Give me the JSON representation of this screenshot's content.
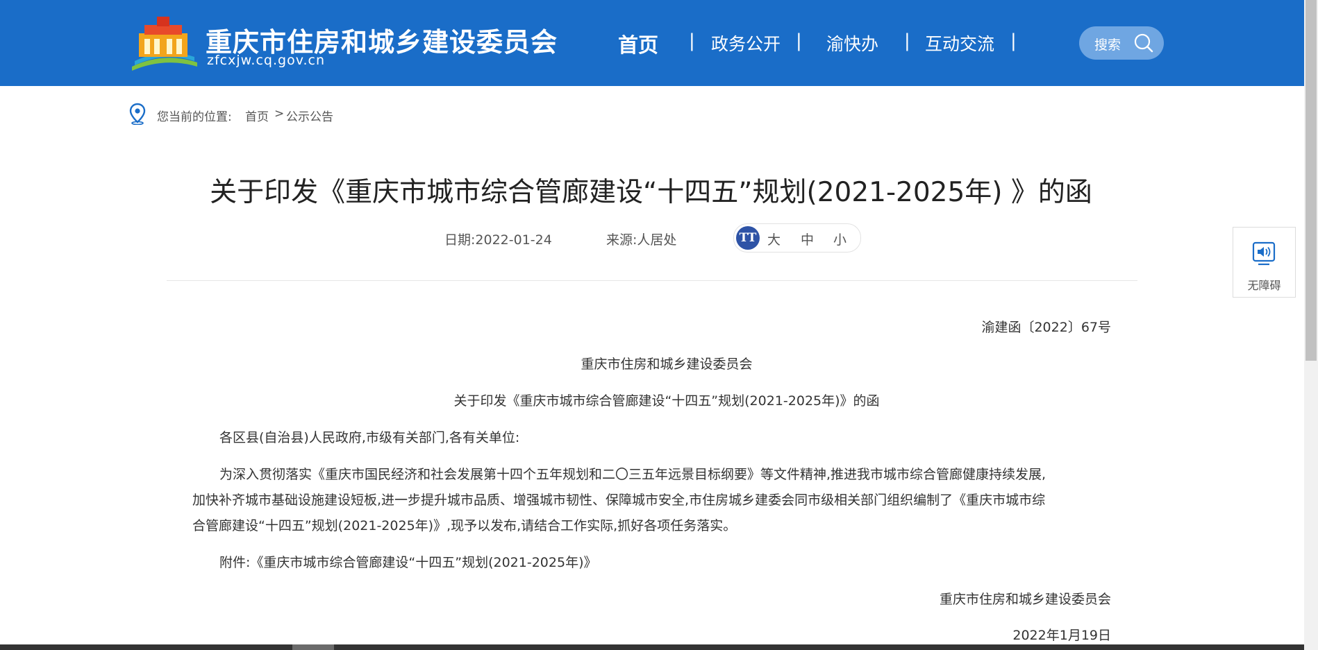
{
  "header": {
    "site_title": "重庆市住房和城乡建设委员会",
    "site_domain": "zfcxjw.cq.gov.cn",
    "nav": [
      "首页",
      "政务公开",
      "渝快办",
      "互动交流"
    ],
    "nav_separator": "|",
    "search_label": "搜索"
  },
  "breadcrumb": {
    "label": "您当前的位置:",
    "home": "首页",
    "separator": ">",
    "current": "公示公告"
  },
  "article": {
    "title": "关于印发《重庆市城市综合管廊建设“十四五”规划(2021-2025年) 》的函",
    "date": "日期:2022-01-24",
    "source": "来源:人居处",
    "font_size": {
      "icon_text": "TT",
      "large": "大",
      "medium": "中",
      "small": "小"
    },
    "doc_number": "渝建函〔2022〕67号",
    "issuer_header": "重庆市住房和城乡建设委员会",
    "subtitle": "关于印发《重庆市城市综合管廊建设“十四五”规划(2021-2025年)》的函",
    "salutation": "各区县(自治县)人民政府,市级有关部门,各有关单位:",
    "body_lines": [
      "为深入贯彻落实《重庆市国民经济和社会发展第十四个五年规划和二〇三五年远景目标纲要》等文件精神,推进我市城市综合管廊健康持续发展,",
      "加快补齐城市基础设施建设短板,进一步提升城市品质、增强城市韧性、保障城市安全,市住房城乡建委会同市级相关部门组织编制了《重庆市城市综",
      "合管廊建设“十四五”规划(2021-2025年)》,现予以发布,请结合工作实际,抓好各项任务落实。"
    ],
    "attachment": "附件:《重庆市城市综合管廊建设“十四五”规划(2021-2025年)》",
    "signature": "重庆市住房和城乡建设委员会",
    "sign_date": "2022年1月19日"
  },
  "accessibility": {
    "label": "无障碍"
  },
  "colors": {
    "header_bg": "#1a6dc8",
    "search_bg": "#6fa6e2",
    "font_icon_bg": "#2e53a6"
  }
}
